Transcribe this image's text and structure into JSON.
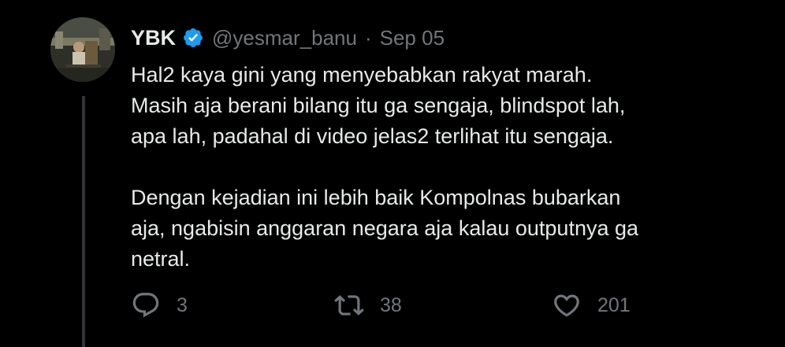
{
  "author": {
    "display_name": "YBK",
    "handle": "@yesmar_banu",
    "separator": "·",
    "date": "Sep 05",
    "verified_icon": "verified-badge-icon",
    "verified_color": "#1d9bf0"
  },
  "tweet": {
    "paragraphs": [
      {
        "lines": [
          "Hal2 kaya gini yang menyebabkan rakyat marah.",
          "Masih aja berani bilang itu ga sengaja, blindspot lah,",
          "apa lah, padahal di video jelas2 terlihat itu sengaja."
        ]
      },
      {
        "lines": [
          "Dengan kejadian ini lebih baik Kompolnas bubarkan",
          "aja, ngabisin anggaran negara aja kalau outputnya ga",
          "netral."
        ]
      }
    ]
  },
  "actions": {
    "reply": {
      "icon": "reply-icon",
      "count": "3"
    },
    "retweet": {
      "icon": "retweet-icon",
      "count": "38"
    },
    "like": {
      "icon": "heart-icon",
      "count": "201"
    }
  },
  "colors": {
    "background": "#000000",
    "text_primary": "#e7e9ea",
    "text_secondary": "#71767b",
    "thread_line": "#333639"
  }
}
